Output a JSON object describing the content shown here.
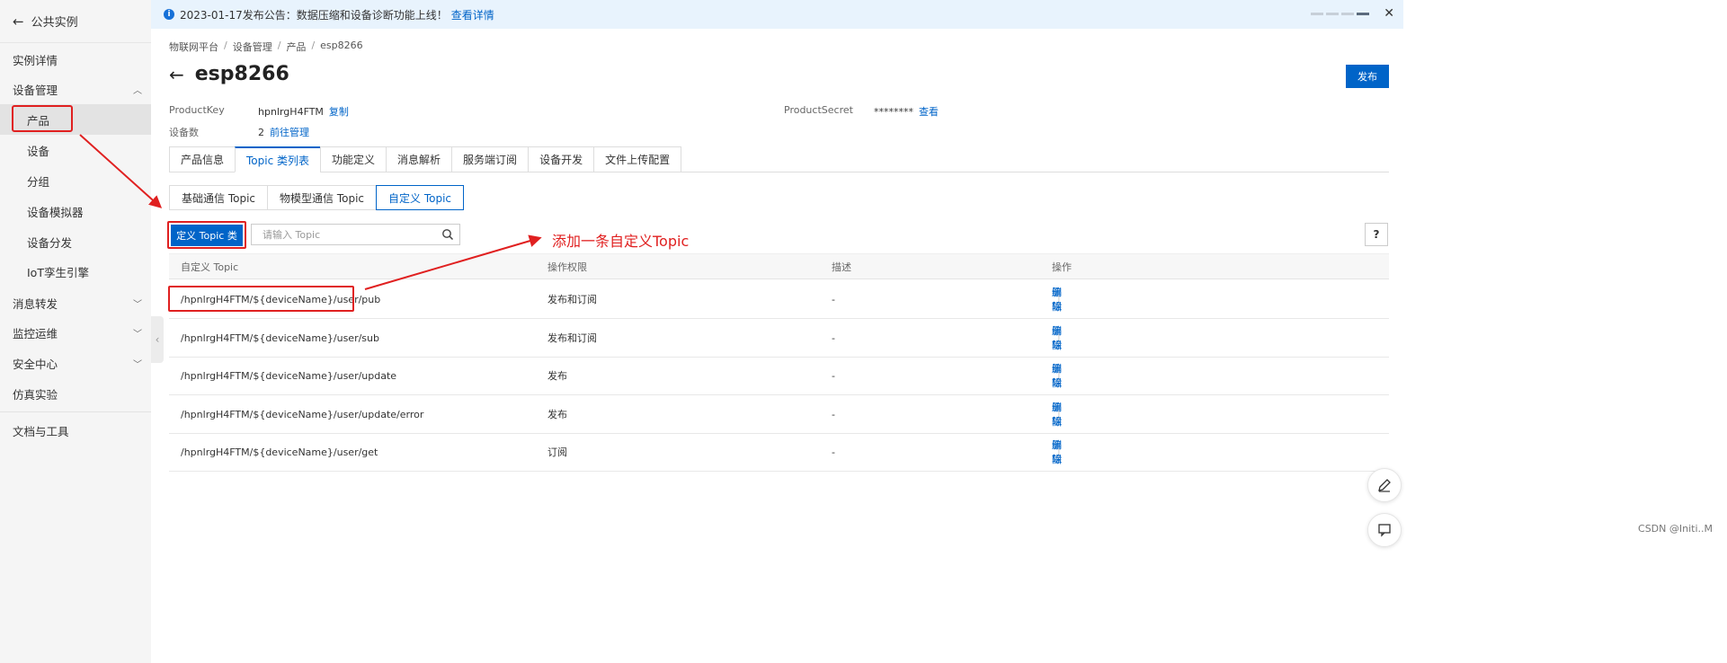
{
  "sidebar": {
    "back_label": "公共实例",
    "items": [
      {
        "label": "实例详情"
      },
      {
        "label": "设备管理"
      },
      {
        "label": "产品"
      },
      {
        "label": "设备"
      },
      {
        "label": "分组"
      },
      {
        "label": "设备模拟器"
      },
      {
        "label": "设备分发"
      },
      {
        "label": "IoT孪生引擎"
      },
      {
        "label": "消息转发"
      },
      {
        "label": "监控运维"
      },
      {
        "label": "安全中心"
      },
      {
        "label": "仿真实验"
      },
      {
        "label": "文档与工具"
      }
    ]
  },
  "notice": {
    "text": "2023-01-17发布公告：数据压缩和设备诊断功能上线！",
    "link": "查看详情"
  },
  "breadcrumb": [
    "物联网平台",
    "设备管理",
    "产品",
    "esp8266"
  ],
  "breadcrumb_sep": "/",
  "page": {
    "title": "esp8266",
    "publish_label": "发布"
  },
  "meta": {
    "product_key_label": "ProductKey",
    "product_key_value": "hpnlrgH4FTM",
    "copy_label": "复制",
    "device_count_label": "设备数",
    "device_count_value": "2",
    "manage_label": "前往管理",
    "product_secret_label": "ProductSecret",
    "product_secret_value": "********",
    "view_label": "查看"
  },
  "tabs": [
    "产品信息",
    "Topic 类列表",
    "功能定义",
    "消息解析",
    "服务端订阅",
    "设备开发",
    "文件上传配置"
  ],
  "active_tab": 1,
  "subtabs": [
    "基础通信 Topic",
    "物模型通信 Topic",
    "自定义 Topic"
  ],
  "active_subtab": 2,
  "toolbar": {
    "define_button": "定义 Topic 类",
    "search_placeholder": "请输入 Topic",
    "help_label": "?"
  },
  "annotation": "添加一条自定义Topic",
  "table": {
    "headers": [
      "自定义 Topic",
      "操作权限",
      "描述",
      "操作"
    ],
    "rows": [
      {
        "topic": "/hpnlrgH4FTM/${deviceName}/user/pub",
        "permission": "发布和订阅",
        "desc": "-"
      },
      {
        "topic": "/hpnlrgH4FTM/${deviceName}/user/sub",
        "permission": "发布和订阅",
        "desc": "-"
      },
      {
        "topic": "/hpnlrgH4FTM/${deviceName}/user/update",
        "permission": "发布",
        "desc": "-"
      },
      {
        "topic": "/hpnlrgH4FTM/${deviceName}/user/update/error",
        "permission": "发布",
        "desc": "-"
      },
      {
        "topic": "/hpnlrgH4FTM/${deviceName}/user/get",
        "permission": "订阅",
        "desc": "-"
      }
    ],
    "edit_label": "编辑",
    "op_sep": "|",
    "delete_label": "删除"
  },
  "watermark": "CSDN @Initi..M",
  "colors": {
    "primary": "#0064c8",
    "annotation_red": "#e02020",
    "sidebar_bg": "#f5f5f5",
    "notice_bg": "#e8f3fd"
  }
}
